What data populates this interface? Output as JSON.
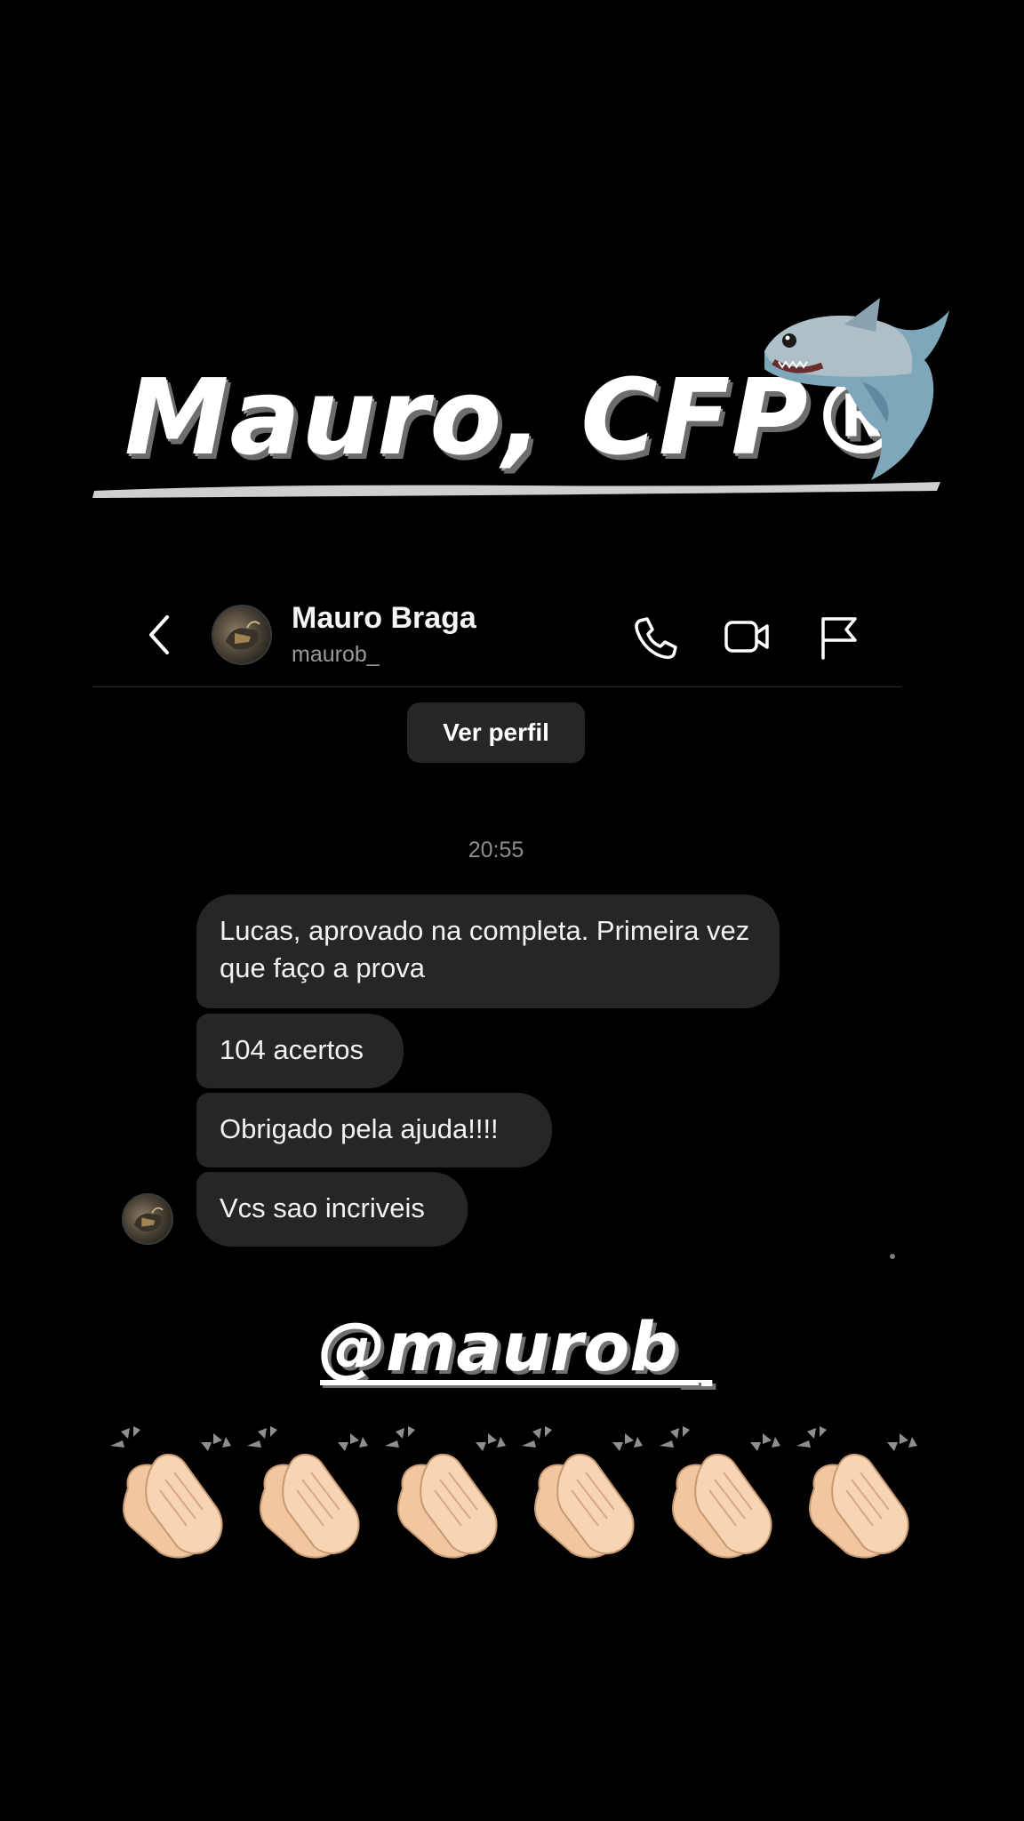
{
  "title": {
    "text": "Mauro, CFP®",
    "emoji": "shark"
  },
  "chat_header": {
    "back_icon": "chevron-left-icon",
    "contact_name": "Mauro Braga",
    "contact_handle": "maurob_",
    "actions": [
      "phone-icon",
      "video-camera-icon",
      "flag-icon"
    ]
  },
  "profile_button": {
    "label": "Ver perfil"
  },
  "conversation": {
    "timestamp": "20:55",
    "messages": [
      {
        "text": "Lucas, aprovado na completa. Primeira vez que faço a prova"
      },
      {
        "text": "104 acertos"
      },
      {
        "text": "Obrigado pela ajuda!!!!"
      },
      {
        "text": "Vcs sao incriveis"
      }
    ]
  },
  "footer": {
    "handle": "@maurob_",
    "clap_emoji": "clapping-hands",
    "clap_count": 6
  },
  "colors": {
    "background": "#000000",
    "bubble": "#262626",
    "secondary_text": "#8e8e8e",
    "skin": "#f1c7a1"
  }
}
